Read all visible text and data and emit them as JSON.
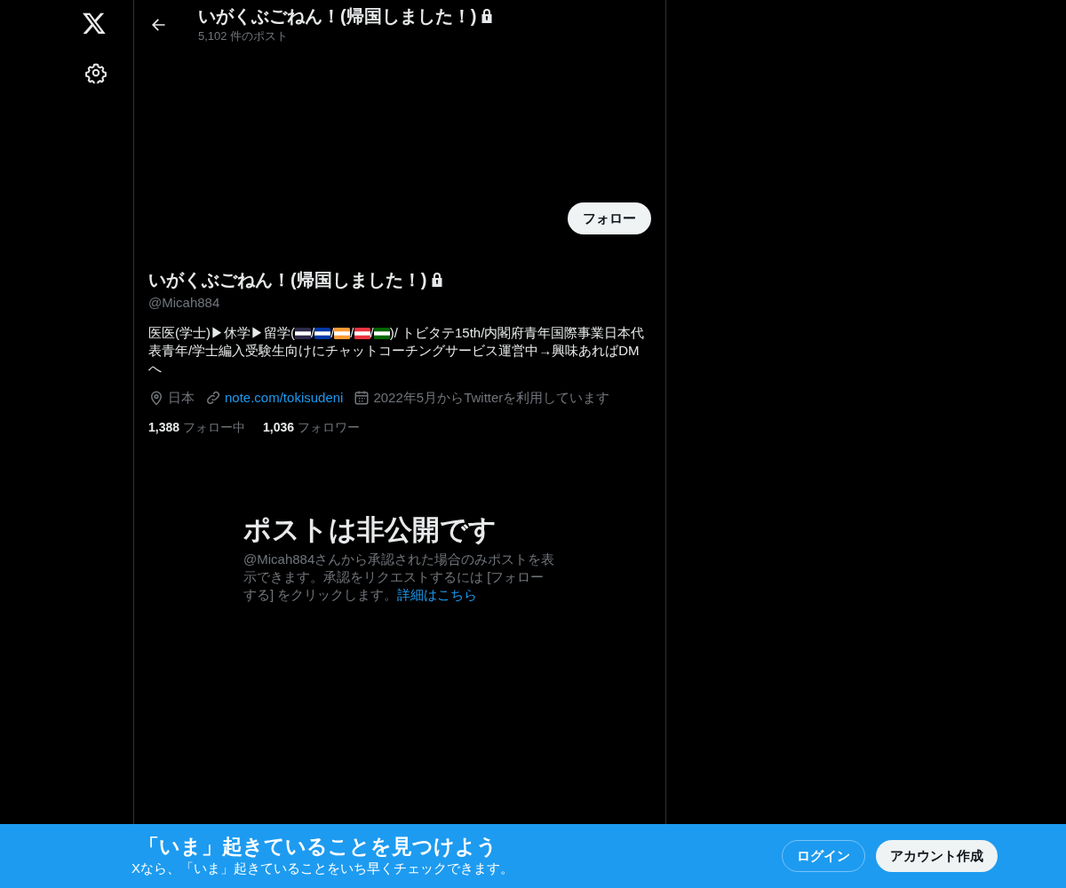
{
  "header": {
    "title": "いがくぶごねん！(帰国しました！)",
    "protected": true,
    "post_count": "5,102 件のポスト"
  },
  "follow_button": "フォロー",
  "profile": {
    "name": "いがくぶごねん！(帰国しました！)",
    "protected": true,
    "handle": "@Micah884",
    "bio": [
      {
        "kind": "text",
        "text": "医医(学士)▶休学▶留学("
      },
      {
        "kind": "flag",
        "color": "#2d2a4a"
      },
      {
        "kind": "text",
        "text": "/"
      },
      {
        "kind": "flag",
        "color": "#0038a8"
      },
      {
        "kind": "text",
        "text": "/"
      },
      {
        "kind": "flag",
        "color": "#ff9933"
      },
      {
        "kind": "text",
        "text": "/"
      },
      {
        "kind": "flag",
        "color": "#ef3340"
      },
      {
        "kind": "text",
        "text": "/"
      },
      {
        "kind": "flag",
        "color": "#006600"
      },
      {
        "kind": "text",
        "text": ")/ トビタテ15th/内閣府青年国際事業日本代表青年/学士編入受験生向けにチャットコーチングサービス運営中→興味あればDMへ"
      }
    ],
    "meta": [
      {
        "kind": "location",
        "text": "日本"
      },
      {
        "kind": "link",
        "text": "note.com/tokisudeni"
      },
      {
        "kind": "joined",
        "text": "2022年5月からTwitterを利用しています"
      }
    ],
    "stats": [
      {
        "count": "1,388",
        "label": "フォロー中"
      },
      {
        "count": "1,036",
        "label": "フォロワー"
      }
    ]
  },
  "private_notice": {
    "title": "ポストは非公開です",
    "body": "@Micah884さんから承認された場合のみポストを表示できます。承認をリクエストするには [フォローする] をクリックします。",
    "link": "詳細はこちら"
  },
  "banner": {
    "title": "「いま」起きていることを見つけよう",
    "subtitle": "Xなら、「いま」起きていることをいち早くチェックできます。",
    "buttons": [
      {
        "kind": "outline",
        "label": "ログイン"
      },
      {
        "kind": "filled",
        "label": "アカウント作成"
      }
    ]
  }
}
